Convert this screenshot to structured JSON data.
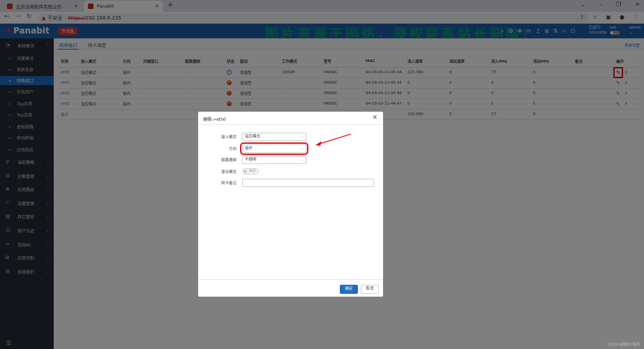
{
  "browser": {
    "tabs": [
      {
        "title": "北京派网软件有限公司"
      },
      {
        "title": "Panabit"
      }
    ],
    "url_warning": "不安全",
    "url_scheme": "https://",
    "url_host": "192.168.6.235"
  },
  "header": {
    "logo": "Panabit",
    "edition": "专业版",
    "watermark": "图片来源于网络，侵权联系站长删除！",
    "status_lines": [
      "已运行",
      "1h1m00s"
    ],
    "ssh_label": "ssh",
    "user": "admin"
  },
  "sidebar": {
    "groups_top": [
      {
        "label": "系统概况",
        "icon": "dashboard-icon"
      }
    ],
    "items": [
      {
        "label": "流量概况"
      },
      {
        "label": "系统信息"
      },
      {
        "label": "网络接口",
        "active": true
      },
      {
        "label": "在线用户"
      },
      {
        "label": "Top应用"
      },
      {
        "label": "Top连接"
      },
      {
        "label": "虚拟链路"
      },
      {
        "label": "移动终端"
      },
      {
        "label": "应用商店"
      }
    ],
    "groups": [
      {
        "label": "当前策略"
      },
      {
        "label": "对象管理"
      },
      {
        "label": "应用路由"
      },
      {
        "label": "流量管理"
      },
      {
        "label": "其它管控"
      },
      {
        "label": "用户认证"
      },
      {
        "label": "无线AC"
      },
      {
        "label": "应用识别"
      },
      {
        "label": "系统维护"
      }
    ]
  },
  "main": {
    "tabs": [
      {
        "label": "网络接口",
        "active": true
      },
      {
        "label": "网卡调度"
      }
    ],
    "system_settings": "系统设置",
    "table": {
      "headers": [
        "名称",
        "接入模式",
        "方向",
        "对端接口",
        "链路捆绑",
        "状态",
        "驱动",
        "工作模式",
        "型号",
        "MAC",
        "流入速率",
        "流出速率",
        "流入PPS",
        "流出PPS",
        "备注",
        "操作"
      ],
      "rows": [
        {
          "name": "eth0",
          "mode": "监控模式",
          "dir": "接外",
          "peer": "-",
          "bond": "-",
          "status": "up",
          "driver": "增强型",
          "work": "1000M",
          "model": "PAENIC",
          "mac": "94-09-d3-11-44-44",
          "in_rate": "223.06K",
          "out_rate": "0",
          "in_pps": "77",
          "out_pps": "0",
          "note": ""
        },
        {
          "name": "eth1",
          "mode": "监控模式",
          "dir": "接内",
          "peer": "-",
          "bond": "-",
          "status": "down",
          "driver": "增强型",
          "work": "-",
          "model": "PAENIC",
          "mac": "94-09-d3-11-44-45",
          "in_rate": "0",
          "out_rate": "0",
          "in_pps": "0",
          "out_pps": "0",
          "note": ""
        },
        {
          "name": "eth2",
          "mode": "监控模式",
          "dir": "接内",
          "peer": "-",
          "bond": "-",
          "status": "down",
          "driver": "增强型",
          "work": "-",
          "model": "PAENIC",
          "mac": "94-09-d3-11-44-46",
          "in_rate": "0",
          "out_rate": "0",
          "in_pps": "0",
          "out_pps": "0",
          "note": ""
        },
        {
          "name": "eth3",
          "mode": "监控模式",
          "dir": "接内",
          "peer": "-",
          "bond": "-",
          "status": "down",
          "driver": "增强型",
          "work": "-",
          "model": "PAENIC",
          "mac": "94-09-d3-11-44-47",
          "in_rate": "0",
          "out_rate": "0",
          "in_pps": "0",
          "out_pps": "0",
          "note": ""
        }
      ],
      "total": {
        "label": "合计",
        "in_rate": "223.06K",
        "out_rate": "0",
        "in_pps": "77",
        "out_pps": "0"
      }
    }
  },
  "modal": {
    "title": "编辑->eth0",
    "fields": {
      "mode_label": "接入模式",
      "mode_value": "监控模式",
      "dir_label": "方向",
      "dir_value": "接外",
      "bond_label": "链路捆绑",
      "bond_value": "不捆绑",
      "promisc_label": "混合模式",
      "promisc_value": "关闭",
      "note_label": "网卡备注",
      "note_value": ""
    },
    "ok": "确定",
    "cancel": "取消"
  },
  "credit": "CSDN @网络工程师"
}
